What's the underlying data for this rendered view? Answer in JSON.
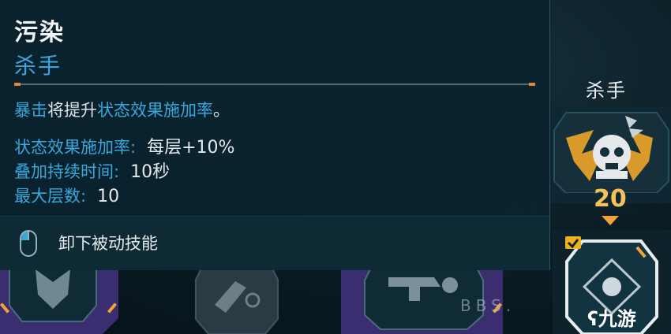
{
  "tooltip": {
    "title": "污染",
    "subtitle": "杀手",
    "description": {
      "part1": "暴击",
      "part2": "将提升",
      "part3": "状态效果施加率",
      "part4": "。"
    },
    "stats": [
      {
        "label": "状态效果施加率:",
        "value": "每层+10%"
      },
      {
        "label": "叠加持续时间:",
        "value": "10秒"
      },
      {
        "label": "最大层数:",
        "value": "10"
      }
    ],
    "footer_action": "卸下被动技能"
  },
  "right_panel": {
    "title": "杀手",
    "level": "20"
  },
  "watermark": {
    "bbs": "BBS.",
    "site": "九游"
  },
  "colors": {
    "accent_blue": "#3aa7da",
    "accent_gold": "#f5c25a",
    "divider_cap": "#e0883a"
  }
}
